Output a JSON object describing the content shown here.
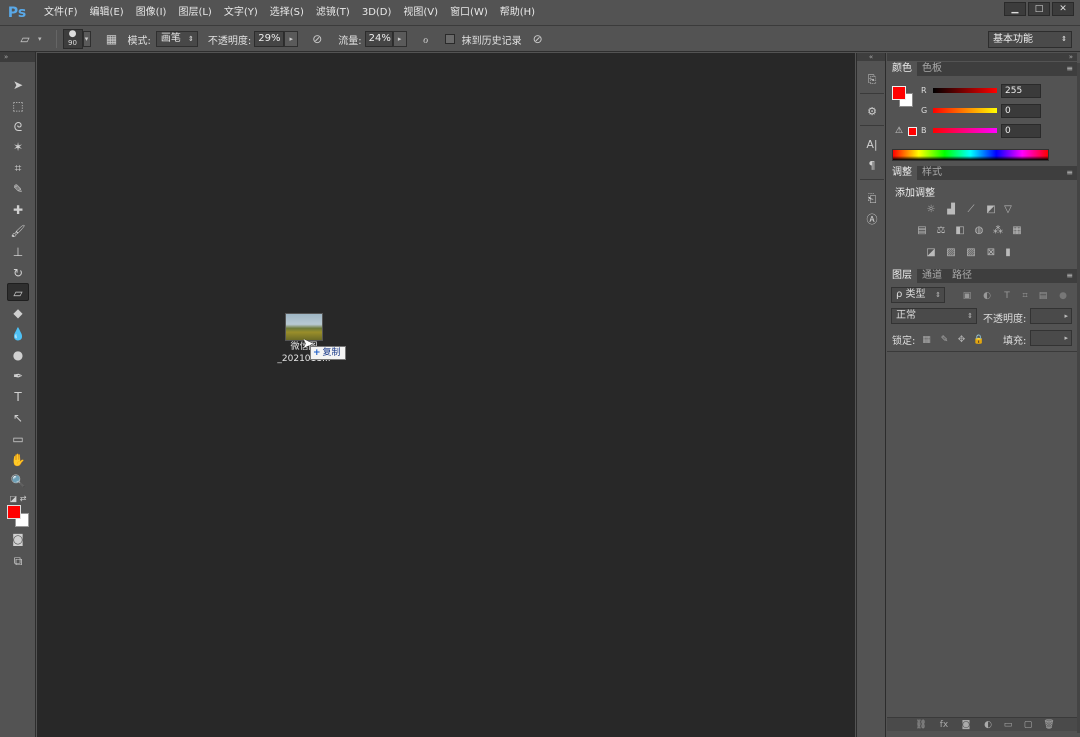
{
  "app": {
    "logo": "Ps",
    "menu": [
      "文件(F)",
      "编辑(E)",
      "图像(I)",
      "图层(L)",
      "文字(Y)",
      "选择(S)",
      "滤镜(T)",
      "3D(D)",
      "视图(V)",
      "窗口(W)",
      "帮助(H)"
    ],
    "window_controls": [
      "▁",
      "□",
      "✕"
    ]
  },
  "options": {
    "brush_size": "90",
    "mode_label": "模式:",
    "mode_value": "画笔",
    "opacity_label": "不透明度:",
    "opacity_value": "29%",
    "flow_label": "流量:",
    "flow_value": "24%",
    "erase_history_label": "抹到历史记录",
    "workspace": "基本功能"
  },
  "canvas": {
    "file_name_line1": "微信图",
    "file_name_line2": "_2021011...",
    "tooltip_plus": "+",
    "tooltip_label": "复制"
  },
  "panels": {
    "color_tabs": [
      "颜色",
      "色板"
    ],
    "channels": {
      "r_label": "R",
      "r_value": "255",
      "g_label": "G",
      "g_value": "0",
      "b_label": "B",
      "b_value": "0"
    },
    "adjust_tabs": [
      "调整",
      "样式"
    ],
    "adjust_title": "添加调整",
    "layers_tabs": [
      "图层",
      "通道",
      "路径"
    ],
    "filter_kind": "ρ 类型",
    "blend_mode": "正常",
    "opacity_label": "不透明度:",
    "lock_label": "锁定:",
    "fill_label": "填充:"
  },
  "colors": {
    "foreground": "#ff0000",
    "background": "#ffffff",
    "canvas_bg": "#282828",
    "chrome": "#535353"
  }
}
